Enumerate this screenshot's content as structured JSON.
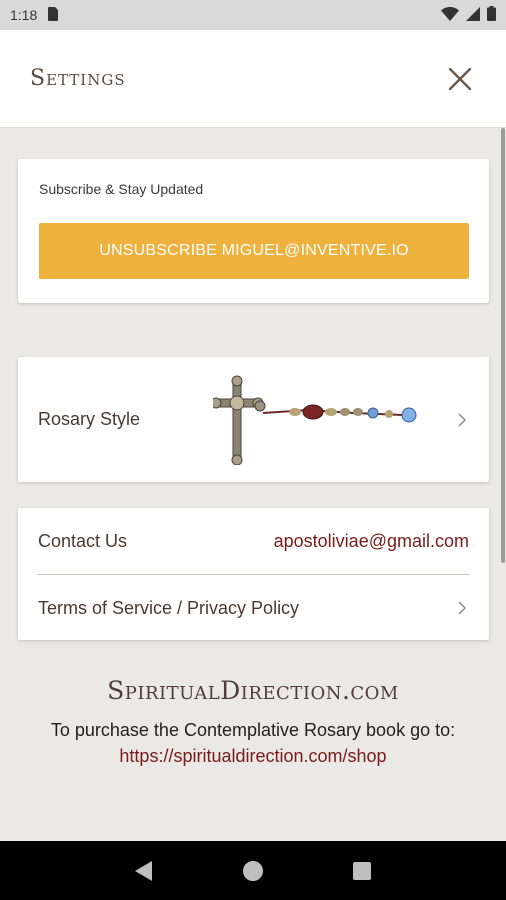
{
  "status_bar": {
    "time": "1:18"
  },
  "header": {
    "title": "Settings"
  },
  "subscribe": {
    "label": "Subscribe & Stay Updated",
    "button_label": "UNSUBSCRIBE MIGUEL@INVENTIVE.IO"
  },
  "rosary": {
    "label": "Rosary Style"
  },
  "contact": {
    "label": "Contact Us",
    "email": "apostoliviae@gmail.com",
    "terms_label": "Terms of Service / Privacy Policy"
  },
  "footer": {
    "logo": "SpiritualDirection.com",
    "text": "To purchase the Contemplative Rosary book go to:",
    "link": "https://spiritualdirection.com/shop"
  },
  "colors": {
    "accent": "#efb13d",
    "link": "#7a1a1a",
    "background": "#ebe9e6"
  },
  "icons": [
    "sim-card-icon",
    "wifi-icon",
    "signal-icon",
    "battery-icon",
    "close-icon",
    "chevron-right-icon",
    "back-icon",
    "home-icon",
    "recents-icon"
  ]
}
